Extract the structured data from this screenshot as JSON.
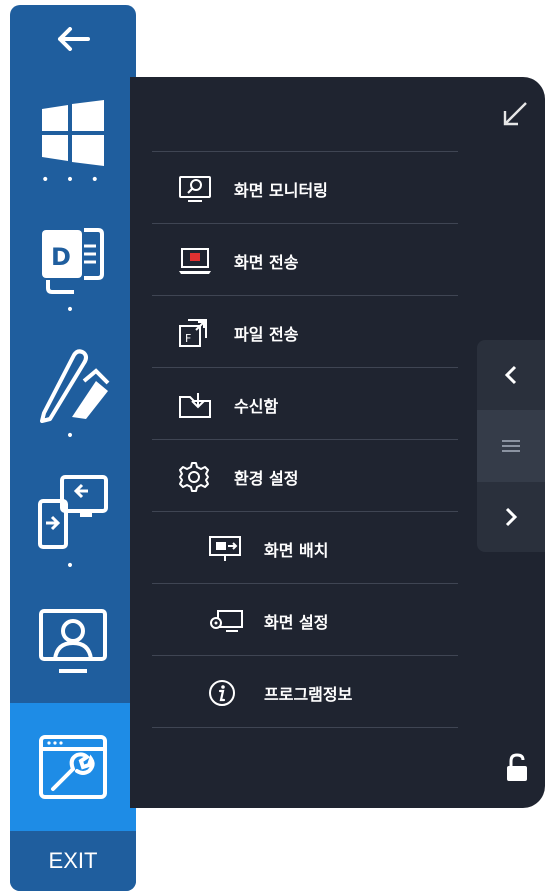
{
  "rail": {
    "back_icon": "arrow-left-icon",
    "items": [
      {
        "name": "windows-icon",
        "dots": "• • •"
      },
      {
        "name": "document-d-icon",
        "dots": "•"
      },
      {
        "name": "pen-eraser-icon",
        "dots": "•"
      },
      {
        "name": "screen-share-icon",
        "dots": "•"
      },
      {
        "name": "user-monitor-icon",
        "dots": ""
      },
      {
        "name": "settings-window-icon",
        "dots": ""
      }
    ],
    "exit_label": "EXIT"
  },
  "menu": {
    "items": [
      {
        "label": "화면 모니터링",
        "icon": "monitor-search-icon"
      },
      {
        "label": "화면 전송",
        "icon": "laptop-broadcast-icon"
      },
      {
        "label": "파일 전송",
        "icon": "file-transfer-icon"
      },
      {
        "label": "수신함",
        "icon": "inbox-folder-icon"
      },
      {
        "label": "환경 설정",
        "icon": "gear-icon"
      },
      {
        "label": "화면 배치",
        "icon": "screen-layout-icon"
      },
      {
        "label": "화면 설정",
        "icon": "screen-settings-icon"
      },
      {
        "label": "프로그램정보",
        "icon": "info-icon"
      }
    ]
  },
  "colors": {
    "rail": "#1f5e9e",
    "rail_active": "#1e8ce6",
    "panel": "#1f2430",
    "accent_red": "#e03131"
  }
}
